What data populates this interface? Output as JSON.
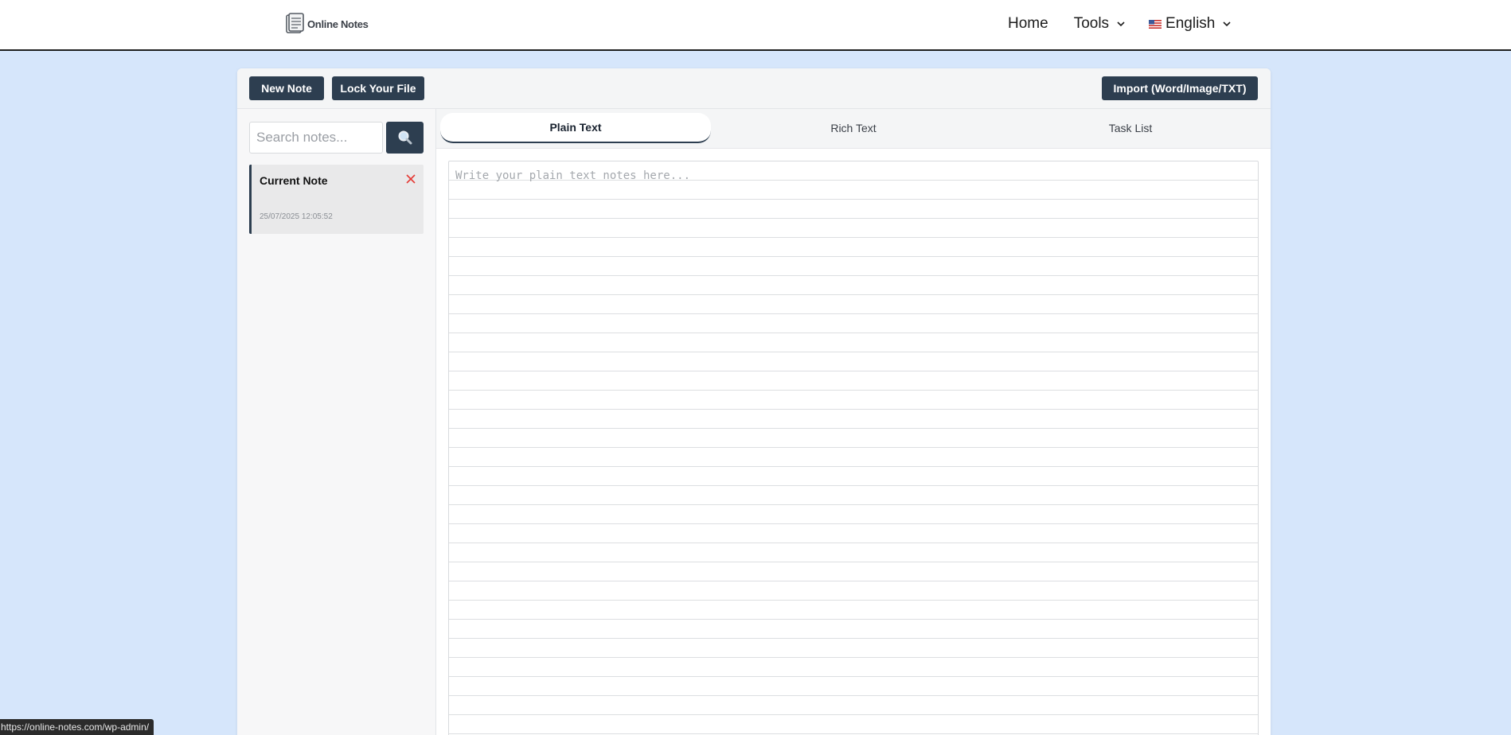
{
  "header": {
    "logo_text": "Online Notes",
    "nav": {
      "home": "Home",
      "tools": "Tools",
      "language": "English"
    }
  },
  "toolbar": {
    "new_note": "New Note",
    "lock_file": "Lock Your File",
    "import": "Import (Word/Image/TXT)"
  },
  "sidebar": {
    "search_placeholder": "Search notes...",
    "notes": [
      {
        "title": "Current Note",
        "date": "25/07/2025 12:05:52"
      }
    ]
  },
  "tabs": [
    {
      "label": "Plain Text",
      "active": true
    },
    {
      "label": "Rich Text",
      "active": false
    },
    {
      "label": "Task List",
      "active": false
    }
  ],
  "editor": {
    "placeholder": "Write your plain text notes here...",
    "value": ""
  },
  "status_bar": {
    "url": "https://online-notes.com/wp-admin/"
  },
  "colors": {
    "page_background": "#d6e6fb",
    "button": "#2d3e50",
    "delete_icon": "#e53935"
  }
}
